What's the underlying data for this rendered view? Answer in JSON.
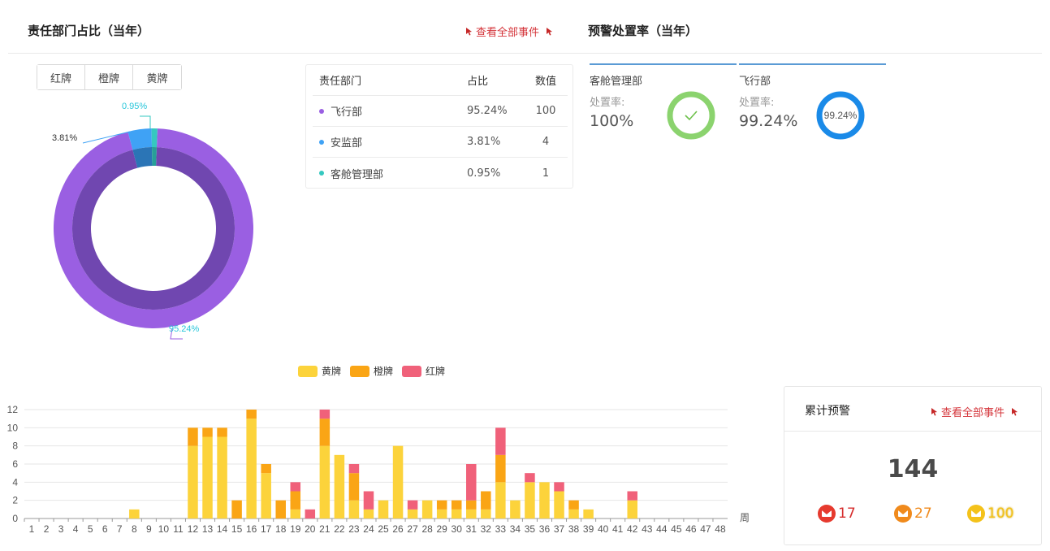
{
  "left_panel": {
    "title": "责任部门占比（当年）",
    "view_all": "查看全部事件",
    "card_filter": [
      "红牌",
      "橙牌",
      "黄牌"
    ],
    "pie": {
      "slices": [
        {
          "name": "飞行部",
          "pct": 95.24,
          "label": "95.24%",
          "color": "#9a5fe2",
          "inner_color": "#7047b0",
          "label_color": "#26c6da"
        },
        {
          "name": "安监部",
          "pct": 3.81,
          "label": "3.81%",
          "color": "#3fa2f5",
          "inner_color": "#2b75b6",
          "label_color": "#333333"
        },
        {
          "name": "客舱管理部",
          "pct": 0.95,
          "label": "0.95%",
          "color": "#35c8c0",
          "inner_color": "#279f98",
          "label_color": "#26c6da"
        }
      ]
    },
    "table": {
      "headers": [
        "责任部门",
        "占比",
        "数值"
      ],
      "rows": [
        {
          "dept": "飞行部",
          "pct": "95.24%",
          "value": "100",
          "color": "#9a5fe2"
        },
        {
          "dept": "安监部",
          "pct": "3.81%",
          "value": "4",
          "color": "#3fa2f5"
        },
        {
          "dept": "客舱管理部",
          "pct": "0.95%",
          "value": "1",
          "color": "#35c8c0"
        }
      ]
    }
  },
  "right_panel": {
    "title": "预警处置率（当年）",
    "rate_label": "处置率:",
    "cards": [
      {
        "name": "客舱管理部",
        "value": "100%",
        "rate": 1.0,
        "ring_color": "#8bd36e",
        "ring_icon": "check-icon",
        "ring_text": ""
      },
      {
        "name": "飞行部",
        "value": "99.24%",
        "rate": 0.9924,
        "ring_color": "#1a8ae8",
        "ring_icon": "",
        "ring_text": "99.24%"
      }
    ]
  },
  "chart_data": {
    "type": "bar",
    "stacked": true,
    "categories": [
      "1",
      "2",
      "3",
      "4",
      "5",
      "6",
      "7",
      "8",
      "9",
      "10",
      "11",
      "12",
      "13",
      "14",
      "15",
      "16",
      "17",
      "18",
      "19",
      "20",
      "21",
      "22",
      "23",
      "24",
      "25",
      "26",
      "27",
      "28",
      "29",
      "30",
      "31",
      "32",
      "33",
      "34",
      "35",
      "36",
      "37",
      "38",
      "39",
      "40",
      "41",
      "42",
      "43",
      "44",
      "45",
      "46",
      "47",
      "48"
    ],
    "series": [
      {
        "name": "黄牌",
        "color": "#fcd33b",
        "values": [
          0,
          0,
          0,
          0,
          0,
          0,
          0,
          1,
          0,
          0,
          0,
          8,
          9,
          9,
          0,
          11,
          5,
          0,
          1,
          0,
          8,
          7,
          2,
          1,
          2,
          8,
          1,
          2,
          1,
          1,
          1,
          1,
          4,
          2,
          4,
          4,
          3,
          1,
          1,
          0,
          0,
          2,
          0,
          0,
          0,
          0,
          0,
          0
        ]
      },
      {
        "name": "橙牌",
        "color": "#faa515",
        "values": [
          0,
          0,
          0,
          0,
          0,
          0,
          0,
          0,
          0,
          0,
          0,
          2,
          1,
          1,
          2,
          1,
          1,
          2,
          2,
          0,
          3,
          0,
          3,
          0,
          0,
          0,
          0,
          0,
          1,
          1,
          1,
          2,
          3,
          0,
          0,
          0,
          0,
          1,
          0,
          0,
          0,
          0,
          0,
          0,
          0,
          0,
          0,
          0
        ]
      },
      {
        "name": "红牌",
        "color": "#f0617a",
        "values": [
          0,
          0,
          0,
          0,
          0,
          0,
          0,
          0,
          0,
          0,
          0,
          0,
          0,
          0,
          0,
          0,
          0,
          0,
          1,
          1,
          1,
          0,
          1,
          2,
          0,
          0,
          1,
          0,
          0,
          0,
          4,
          0,
          3,
          0,
          1,
          0,
          1,
          0,
          0,
          0,
          0,
          1,
          0,
          0,
          0,
          0,
          0,
          0
        ]
      }
    ],
    "xlabel": "周",
    "ylim": [
      0,
      12
    ],
    "yticks": [
      0,
      2,
      4,
      6,
      8,
      10,
      12
    ],
    "grid": true,
    "legend": "top-center"
  },
  "warn_panel": {
    "title": "累计预警",
    "view_all": "查看全部事件",
    "total": "144",
    "counts": [
      {
        "value": "17",
        "color": "#e63a2e",
        "text_color": "#d62d2d",
        "icon": "red-card-icon"
      },
      {
        "value": "27",
        "color": "#f08a1c",
        "text_color": "#f08a1c",
        "icon": "orange-card-icon"
      },
      {
        "value": "100",
        "color": "#f4c21a",
        "text_color": "#f4c21a",
        "icon": "yellow-card-icon"
      }
    ]
  }
}
